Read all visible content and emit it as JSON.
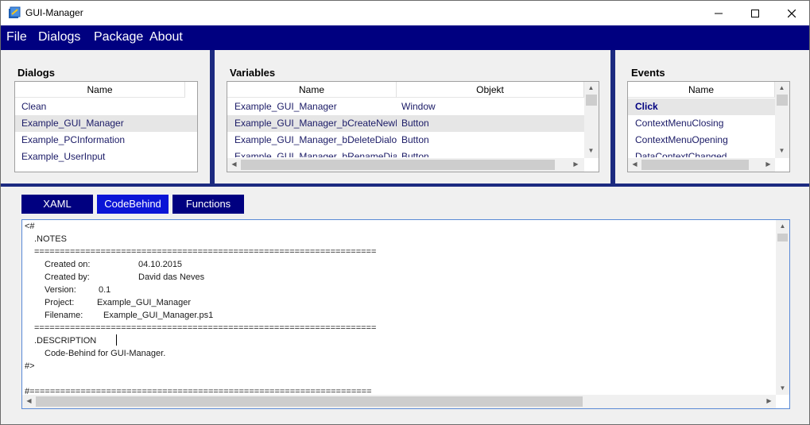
{
  "window": {
    "title": "GUI-Manager"
  },
  "menu": [
    "File",
    "Dialogs",
    "Package",
    "About"
  ],
  "dialogs": {
    "title": "Dialogs",
    "column": "Name",
    "items": [
      "Clean",
      "Example_GUI_Manager",
      "Example_PCInformation",
      "Example_UserInput"
    ],
    "selected_index": 1
  },
  "variables": {
    "title": "Variables",
    "columns": [
      "Name",
      "Objekt"
    ],
    "rows": [
      [
        "Example_GUI_Manager",
        "Window"
      ],
      [
        "Example_GUI_Manager_bCreateNewD",
        "Button"
      ],
      [
        "Example_GUI_Manager_bDeleteDialog",
        "Button"
      ],
      [
        "Example_GUI_Manager_bRenameDial",
        "Button"
      ]
    ],
    "selected_index": 1
  },
  "events": {
    "title": "Events",
    "column": "Name",
    "items": [
      "Click",
      "ContextMenuClosing",
      "ContextMenuOpening",
      "DataContextChanged"
    ],
    "selected_index": 0
  },
  "tabs": [
    "XAML",
    "CodeBehind",
    "Functions"
  ],
  "active_tab": "CodeBehind",
  "code": {
    "l01": "<#",
    "l02": ".NOTES",
    "l03": "===================================================================",
    "l04_key": "Created on:",
    "l04_val": "04.10.2015",
    "l05_key": "Created by:",
    "l05_val": "David das Neves",
    "l06_key": "Version:",
    "l06_val": "0.1",
    "l07_key": "Project:",
    "l07_val": "Example_GUI_Manager",
    "l08_key": "Filename:",
    "l08_val": "Example_GUI_Manager.ps1",
    "l09": "===================================================================",
    "l10": ".DESCRIPTION",
    "l11": "Code-Behind for GUI-Manager.",
    "l12": "#>",
    "l14": "#==================================================================="
  },
  "colors": {
    "menubar": "#000080",
    "tab": "#000080",
    "tab_active": "#0a14d6",
    "separator": "#1c2a80"
  }
}
